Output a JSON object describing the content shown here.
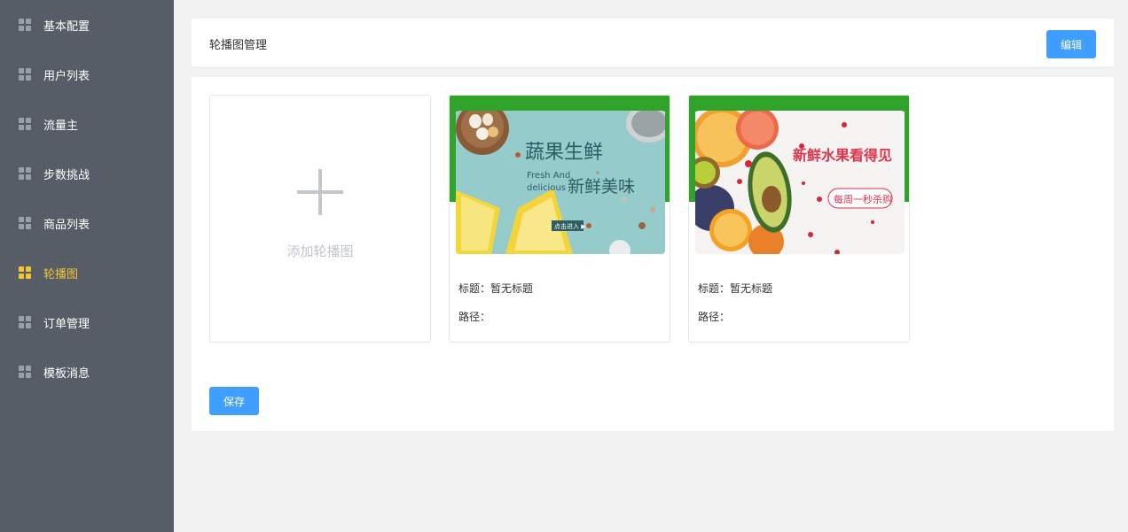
{
  "sidebar": {
    "items": [
      {
        "label": "基本配置",
        "icon": "grid-icon",
        "active": false
      },
      {
        "label": "用户列表",
        "icon": "grid-icon",
        "active": false
      },
      {
        "label": "流量主",
        "icon": "grid-icon",
        "active": false
      },
      {
        "label": "步数挑战",
        "icon": "grid-icon",
        "active": false
      },
      {
        "label": "商品列表",
        "icon": "grid-icon",
        "active": false
      },
      {
        "label": "轮播图",
        "icon": "grid-icon",
        "active": true
      },
      {
        "label": "订单管理",
        "icon": "grid-icon",
        "active": false
      },
      {
        "label": "模板消息",
        "icon": "grid-icon",
        "active": false
      }
    ],
    "active_color": "#f5c233"
  },
  "header": {
    "title": "轮播图管理",
    "edit_label": "编辑"
  },
  "main": {
    "add_label": "添加轮播图",
    "cards": [
      {
        "title_label": "标题：暂无标题",
        "path_label": "路径：",
        "banner": {
          "headline": "蔬果生鲜",
          "subline_en_1": "Fresh And",
          "subline_en_2": "delicious",
          "subline_cn": "新鲜美味",
          "button": "点击进入 ▶"
        }
      },
      {
        "title_label": "标题：暂无标题",
        "path_label": "路径：",
        "banner": {
          "headline": "新鲜水果看得见",
          "tag": "每周一秒杀购"
        }
      }
    ],
    "save_label": "保存"
  },
  "colors": {
    "sidebar_bg": "#565d66",
    "primary": "#409eff",
    "card_accent": "#2fa32a"
  }
}
